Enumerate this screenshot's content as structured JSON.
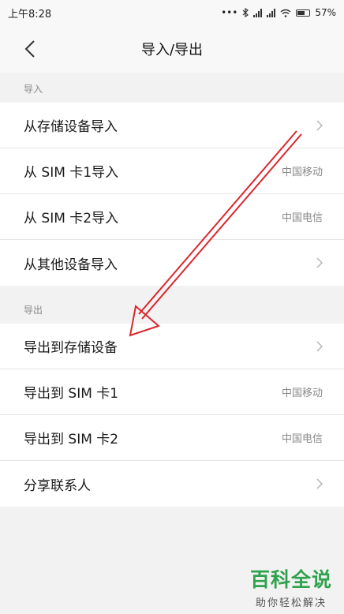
{
  "status_bar": {
    "time": "上午8:28",
    "battery": "57%"
  },
  "header": {
    "title": "导入/导出"
  },
  "import_section": {
    "label": "导入",
    "items": [
      {
        "label": "从存储设备导入",
        "value": ""
      },
      {
        "label": "从 SIM 卡1导入",
        "value": "中国移动"
      },
      {
        "label": "从 SIM 卡2导入",
        "value": "中国电信"
      },
      {
        "label": "从其他设备导入",
        "value": ""
      }
    ]
  },
  "export_section": {
    "label": "导出",
    "items": [
      {
        "label": "导出到存储设备",
        "value": ""
      },
      {
        "label": "导出到 SIM 卡1",
        "value": "中国移动"
      },
      {
        "label": "导出到 SIM 卡2",
        "value": "中国电信"
      },
      {
        "label": "分享联系人",
        "value": ""
      }
    ]
  },
  "watermark": {
    "main": "百科全说",
    "sub": "助你轻松解决"
  },
  "colors": {
    "annotation_arrow": "#d9262c",
    "watermark_green": "#2fa24d"
  },
  "icons": {
    "back": "chevron-left-icon",
    "row_arrow": "chevron-right-icon"
  }
}
